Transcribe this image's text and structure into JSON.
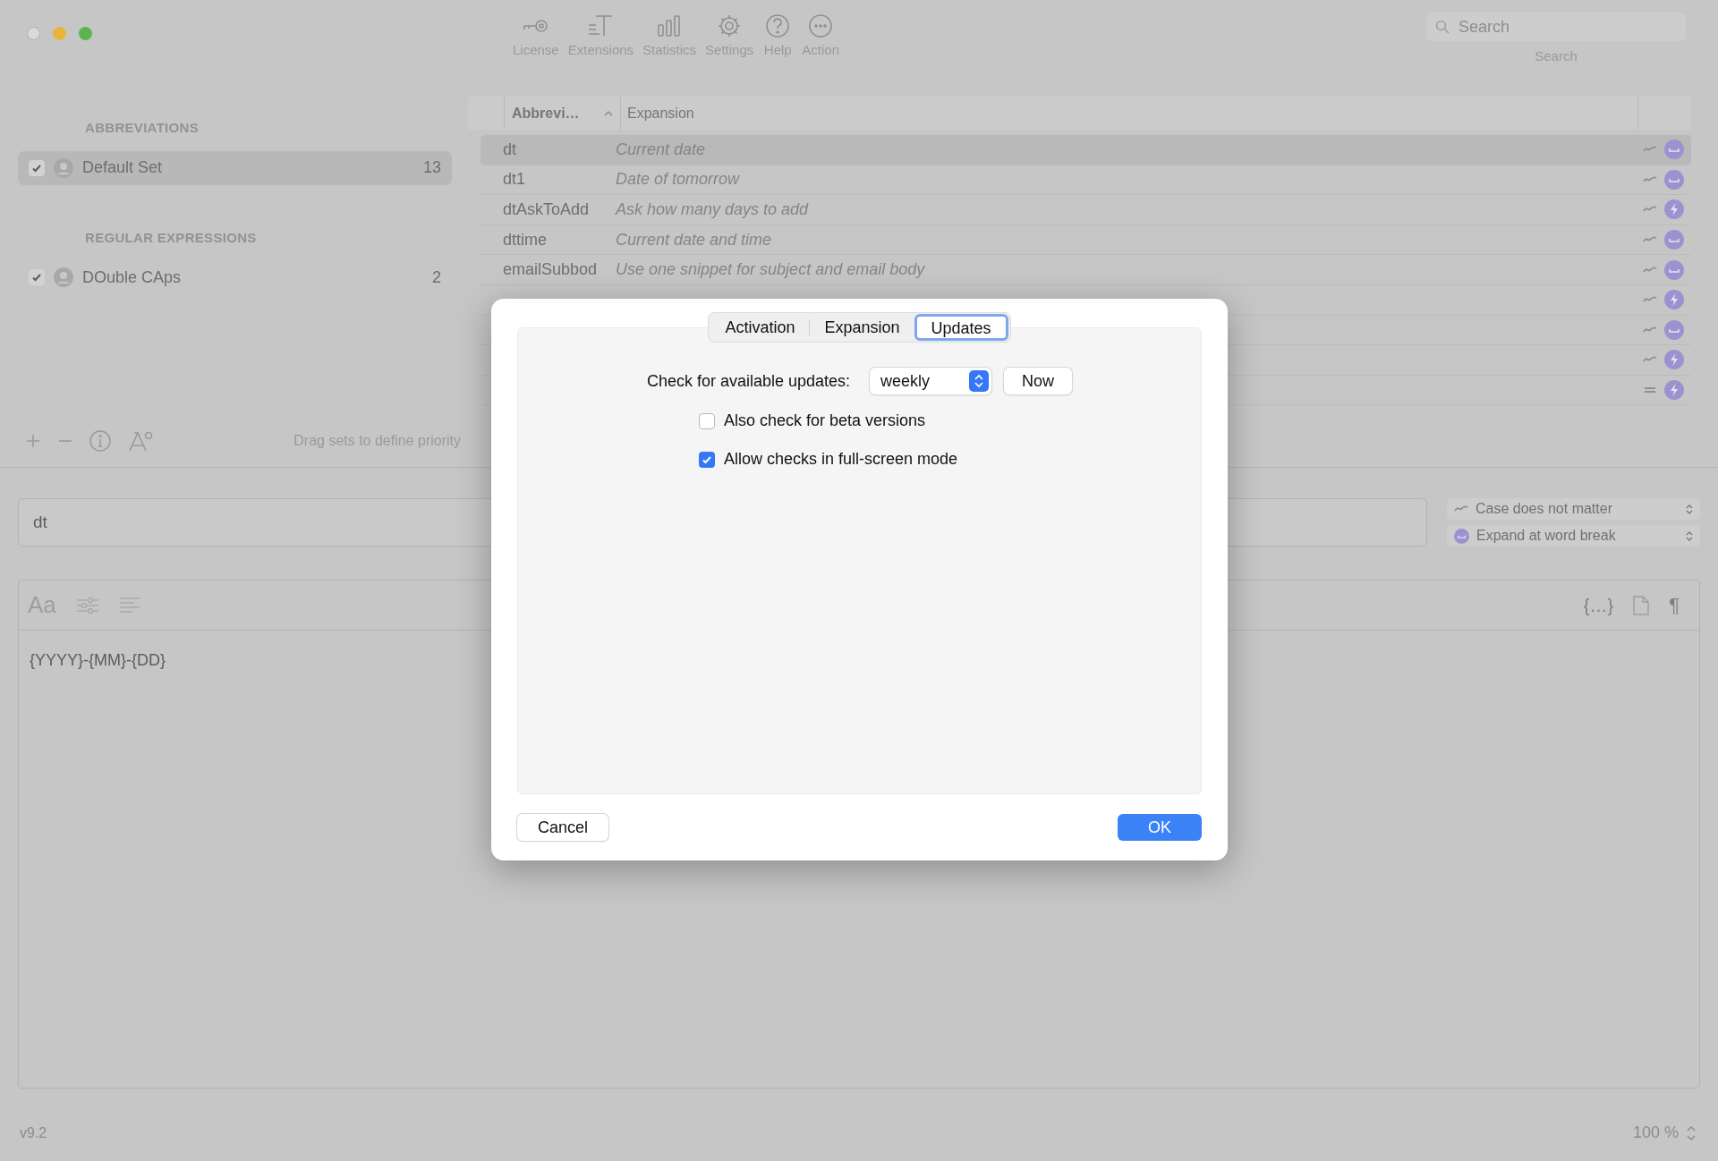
{
  "toolbar": {
    "items": [
      {
        "kind": "key",
        "label": "License"
      },
      {
        "kind": "text",
        "label": "Extensions"
      },
      {
        "kind": "bars",
        "label": "Statistics"
      },
      {
        "kind": "gear",
        "label": "Settings"
      },
      {
        "kind": "help",
        "label": "Help"
      },
      {
        "kind": "more",
        "label": "Action"
      }
    ]
  },
  "search": {
    "placeholder": "Search",
    "label": "Search"
  },
  "sidebar": {
    "sections": [
      {
        "title": "ABBREVIATIONS",
        "sets": [
          {
            "name": "Default Set",
            "count": "13",
            "checked": true,
            "selected": true
          }
        ]
      },
      {
        "title": "REGULAR EXPRESSIONS",
        "sets": [
          {
            "name": "DOuble CAps",
            "count": "2",
            "checked": true,
            "selected": false
          }
        ]
      }
    ],
    "hint": "Drag sets to define priority"
  },
  "table": {
    "columns": [
      {
        "label": "Abbrevi…",
        "sorted_ascending": true
      },
      {
        "label": "Expansion",
        "sorted_ascending": false
      }
    ],
    "rows": [
      {
        "abbreviation": "dt",
        "expansion": "Current date",
        "case_sensitive": false,
        "immediate": false,
        "selected": true
      },
      {
        "abbreviation": "dt1",
        "expansion": "Date of tomorrow",
        "case_sensitive": false,
        "immediate": false,
        "selected": false
      },
      {
        "abbreviation": "dtAskToAdd",
        "expansion": "Ask how many days to add",
        "case_sensitive": false,
        "immediate": true,
        "selected": false
      },
      {
        "abbreviation": "dttime",
        "expansion": "Current date and time",
        "case_sensitive": false,
        "immediate": false,
        "selected": false
      },
      {
        "abbreviation": "emailSubbod",
        "expansion": "Use one snippet for subject and email body",
        "case_sensitive": false,
        "immediate": false,
        "selected": false
      },
      {
        "case_sensitive": false,
        "immediate": true,
        "selected": false
      },
      {
        "case_sensitive": false,
        "immediate": false,
        "selected": false
      },
      {
        "case_sensitive": false,
        "immediate": true,
        "selected": false
      },
      {
        "case_sensitive": true,
        "immediate": true,
        "selected": false
      }
    ]
  },
  "abbreviation_field": {
    "value": "dt"
  },
  "options": [
    {
      "kind": "case",
      "label": "Case does not matter"
    },
    {
      "kind": "trigger",
      "label": "Expand at word break"
    }
  ],
  "editor": {
    "font_button": "Aa",
    "variables_button": "{…}",
    "paragraph_button": "¶",
    "content": "{YYYY}-{MM}-{DD}"
  },
  "status_bar": {
    "version": "v9.2",
    "zoom": "100 %"
  },
  "dialog": {
    "tabs": [
      {
        "label": "Activation",
        "selected": false
      },
      {
        "label": "Expansion",
        "selected": false
      },
      {
        "label": "Updates",
        "selected": true
      }
    ],
    "update_label": "Check for available updates:",
    "frequency": "weekly",
    "now_button": "Now",
    "checkboxes": [
      {
        "label": "Also check for beta versions",
        "checked": false
      },
      {
        "label": "Allow checks in full-screen mode",
        "checked": true
      }
    ],
    "cancel_button": "Cancel",
    "ok_button": "OK"
  }
}
